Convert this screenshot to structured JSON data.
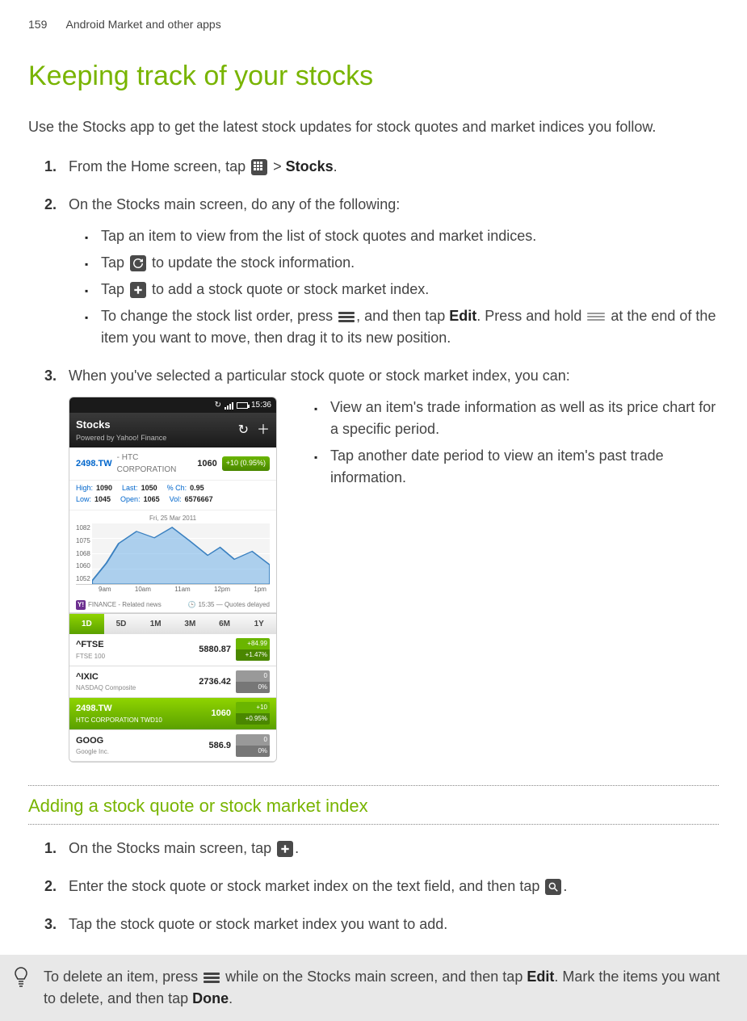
{
  "page": {
    "num": "159",
    "section": "Android Market and other apps"
  },
  "title": "Keeping track of your stocks",
  "intro": "Use the Stocks app to get the latest stock updates for stock quotes and market indices you follow.",
  "steps": {
    "s1": {
      "num": "1.",
      "pre": "From the Home screen, tap ",
      "post": " > ",
      "end": ".",
      "stocks": "Stocks"
    },
    "s2": {
      "num": "2.",
      "text": "On the Stocks main screen, do any of the following:"
    },
    "s2b": {
      "b1": "Tap an item to view from the list of stock quotes and market indices.",
      "b2a": "Tap ",
      "b2b": " to update the stock information.",
      "b3a": "Tap ",
      "b3b": " to add a stock quote or stock market index.",
      "b4a": "To change the stock list order, press ",
      "b4b": ", and then tap ",
      "b4edit": "Edit",
      "b4c": ". Press and hold ",
      "b4d": " at the end of the item you want to move, then drag it to its new position."
    },
    "s3": {
      "num": "3.",
      "text": "When you've selected a particular stock quote or stock market index, you can:"
    },
    "s3b": {
      "b1": "View an item's trade information as well as its price chart for a specific period.",
      "b2": "Tap another date period to view an item's past trade information."
    }
  },
  "screenshot": {
    "time": "15:36",
    "app_title": "Stocks",
    "app_sub": "Powered by Yahoo! Finance",
    "quote": {
      "sym": "2498.TW",
      "name": " - HTC CORPORATION",
      "price": "1060",
      "change": "+10 (0.95%)"
    },
    "details": {
      "high_l": "High:",
      "high": "1090",
      "last_l": "Last:",
      "last": "1050",
      "pct_l": "% Ch:",
      "pct": "0.95",
      "low_l": "Low:",
      "low": "1045",
      "open_l": "Open:",
      "open": "1065",
      "vol_l": "Vol:",
      "vol": "6576667"
    },
    "chart_date": "Fri, 25 Mar 2011",
    "yticks": [
      "1082",
      "1075",
      "1068",
      "1060",
      "1052"
    ],
    "xticks": [
      "9am",
      "10am",
      "11am",
      "12pm",
      "1pm"
    ],
    "finance_left": "FINANCE - Related news",
    "finance_right": "15:35 — Quotes delayed",
    "periods": [
      "1D",
      "5D",
      "1M",
      "3M",
      "6M",
      "1Y"
    ],
    "list": [
      {
        "sym": "^FTSE",
        "full": "FTSE 100",
        "price": "5880.87",
        "c1": "+84.99",
        "c2": "+1.47%",
        "cls": "up"
      },
      {
        "sym": "^IXIC",
        "full": "NASDAQ Composite",
        "price": "2736.42",
        "c1": "0",
        "c2": "0%",
        "cls": "flat"
      },
      {
        "sym": "2498.TW",
        "full": "HTC CORPORATION TWD10",
        "price": "1060",
        "c1": "+10",
        "c2": "+0.95%",
        "cls": "up",
        "sel": true
      },
      {
        "sym": "GOOG",
        "full": "Google Inc.",
        "price": "586.9",
        "c1": "0",
        "c2": "0%",
        "cls": "flat"
      }
    ]
  },
  "sub_heading": "Adding a stock quote or stock market index",
  "add_steps": {
    "a1": {
      "num": "1.",
      "pre": "On the Stocks main screen, tap ",
      "post": "."
    },
    "a2": {
      "num": "2.",
      "pre": "Enter the stock quote or stock market index on the text field, and then tap ",
      "post": "."
    },
    "a3": {
      "num": "3.",
      "text": "Tap the stock quote or stock market index you want to add."
    }
  },
  "tip": {
    "pre": "To delete an item, press ",
    "mid": " while on the Stocks main screen, and then tap ",
    "edit": "Edit",
    "post1": ". Mark the items you want to delete, and then tap ",
    "done": "Done",
    "post2": "."
  },
  "chart_data": {
    "type": "line",
    "title": "2498.TW intraday",
    "x": [
      "9am",
      "10am",
      "11am",
      "12pm",
      "1pm"
    ],
    "values": [
      1052,
      1075,
      1082,
      1072,
      1060,
      1068,
      1060
    ],
    "ylim": [
      1052,
      1082
    ],
    "xlabel": "",
    "ylabel": ""
  }
}
